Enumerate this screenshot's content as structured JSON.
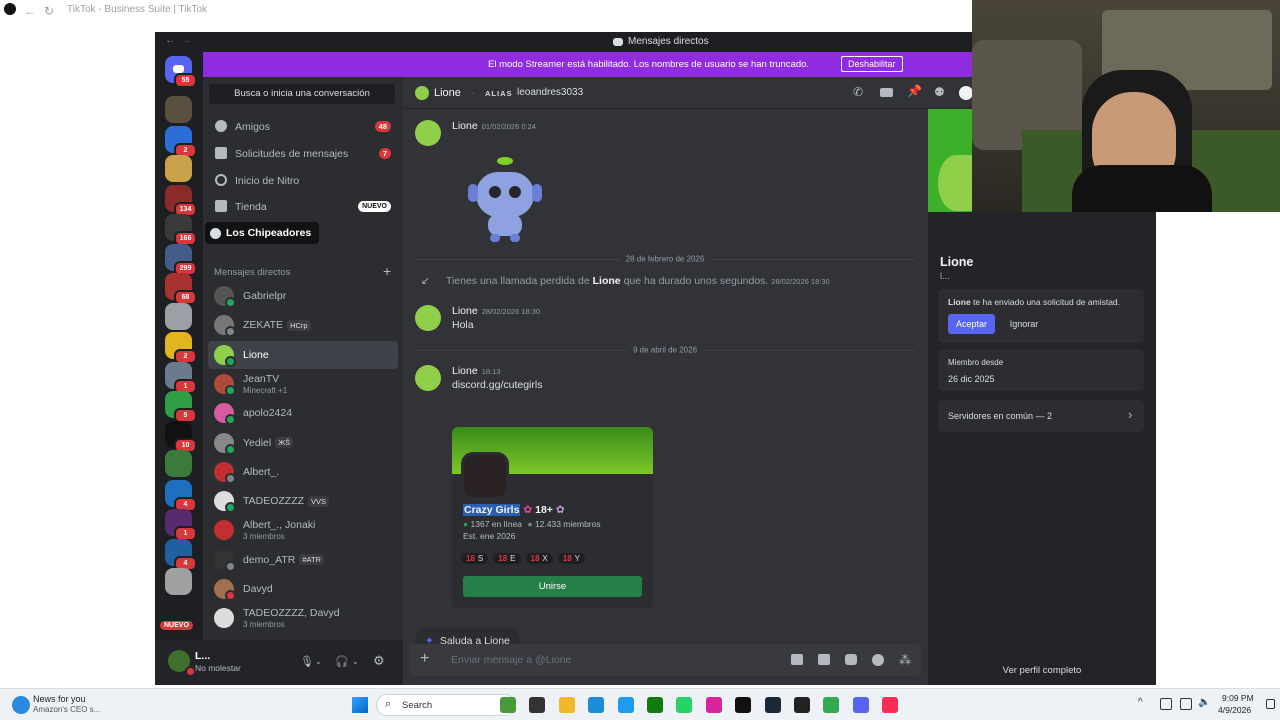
{
  "browser": {
    "tab_title": "TikTok - Business Suite | TikTok"
  },
  "titlebar": {
    "title": "Mensajes directos"
  },
  "servers": {
    "home_badge": "55",
    "items": [
      {
        "color": "#5a5040",
        "badge": ""
      },
      {
        "color": "#2b6fd6",
        "badge": "2"
      },
      {
        "color": "#c9a24a",
        "badge": ""
      },
      {
        "color": "#8a2a2a",
        "badge": "134"
      },
      {
        "color": "#3a3a3a",
        "badge": "166"
      },
      {
        "color": "#445c8a",
        "badge": "299"
      },
      {
        "color": "#a83232",
        "badge": "68"
      },
      {
        "color": "#9aa0a6",
        "badge": ""
      },
      {
        "color": "#e3b422",
        "badge": "2"
      },
      {
        "color": "#6b7a8c",
        "badge": "1"
      },
      {
        "color": "#2f9e44",
        "badge": "5"
      },
      {
        "color": "#111111",
        "badge": "10"
      },
      {
        "color": "#3c7a3c",
        "badge": ""
      },
      {
        "color": "#1f6fbf",
        "badge": "4"
      },
      {
        "color": "#5a2a6e",
        "badge": "1"
      },
      {
        "color": "#2060a0",
        "badge": "4"
      },
      {
        "color": "#a0a0a0",
        "badge": ""
      }
    ],
    "new_label": "NUEVO"
  },
  "streamer": {
    "text": "El modo Streamer está habilitado. Los nombres de usuario se han truncado.",
    "button": "Deshabilitar"
  },
  "sidebar": {
    "search": "Busca o inicia una conversación",
    "nav": [
      {
        "label": "Amigos",
        "badge": "48"
      },
      {
        "label": "Solicitudes de mensajes",
        "badge": "7"
      },
      {
        "label": "Inicio de Nitro",
        "badge": ""
      },
      {
        "label": "Tienda",
        "new": "NUEVO"
      }
    ],
    "tooltip": "Los Chipeadores",
    "dm_header": "Mensajes directos",
    "dms": [
      {
        "name": "Gabrielpr",
        "tag": "",
        "sub": "",
        "color": "#555555",
        "status": "#23a55a"
      },
      {
        "name": "ZEKATE",
        "tag": "HCrp",
        "sub": "",
        "color": "#777777",
        "status": "#80848e"
      },
      {
        "name": "Lione",
        "tag": "",
        "sub": "",
        "color": "#8fcf4a",
        "status": "#23a55a"
      },
      {
        "name": "JeanTV",
        "tag": "",
        "sub": "Minecraft +1",
        "color": "#b04a3a",
        "status": "#23a55a"
      },
      {
        "name": "apolo2424",
        "tag": "",
        "sub": "",
        "color": "#d85aa0",
        "status": "#23a55a"
      },
      {
        "name": "Yediel",
        "tag": "ЖŠ",
        "sub": "",
        "color": "#888888",
        "status": "#23a55a"
      },
      {
        "name": "Albert_.",
        "tag": "",
        "sub": "",
        "color": "#c03030",
        "status": "#80848e"
      },
      {
        "name": "TADEOZZZZ",
        "tag": "VVS",
        "sub": "",
        "color": "#dddddd",
        "status": "#23a55a"
      },
      {
        "name": "Albert_., Jonaki",
        "tag": "",
        "sub": "3 miembros",
        "color": "#c03030",
        "status": ""
      },
      {
        "name": "demo_ATR",
        "tag": "#ATR",
        "sub": "",
        "color": "#333333",
        "status": "#80848e"
      },
      {
        "name": "Davyd",
        "tag": "",
        "sub": "",
        "color": "#a07050",
        "status": "#da373c"
      },
      {
        "name": "TADEOZZZZ, Davyd",
        "tag": "",
        "sub": "3 miembros",
        "color": "#dddddd",
        "status": ""
      }
    ]
  },
  "userbar": {
    "name": "L...",
    "status": "No molestar"
  },
  "chat_header": {
    "name": "Lione",
    "alias_label": "ALIAS",
    "alias": "leoandres3033"
  },
  "messages": [
    {
      "author": "Lione",
      "time": "01/02/2026 0:24",
      "text": ""
    },
    {
      "author": "Lione",
      "time": "28/02/2026 18:30",
      "text": "Hola"
    },
    {
      "author": "Lione",
      "time": "18:13",
      "text": "discord.gg/cutegirls"
    }
  ],
  "dividers": [
    "28 de febrero de 2026",
    "9 de abril de 2026"
  ],
  "missed_call": {
    "prefix": "Tienes una llamada perdida de",
    "name": "Lione",
    "suffix": "que ha durado unos segundos.",
    "time": "28/02/2026 18:30"
  },
  "invite": {
    "name": "Crazy Girls",
    "age": "18+",
    "online": "1367 en línea",
    "members": "12.433 miembros",
    "est": "Est. ene 2026",
    "tags": [
      "S",
      "E",
      "X",
      "Y"
    ],
    "join": "Unirse"
  },
  "wave": "Saluda a Lione",
  "composer": {
    "placeholder": "Enviar mensaje a @Lione"
  },
  "profile": {
    "name": "Lione",
    "sub": "l...",
    "request_name": "Lione",
    "request_text": "te ha enviado una solicitud de amistad.",
    "accept": "Aceptar",
    "ignore": "Ignorar",
    "member_label": "Miembro desde",
    "member_date": "26 dic 2025",
    "common": "Servidores en común — 2",
    "full": "Ver perfil completo"
  },
  "taskbar": {
    "news_title": "News for you",
    "news_sub": "Amazon's CEO s...",
    "search": "Search",
    "time": "9:09 PM",
    "date": "4/9/2026"
  }
}
